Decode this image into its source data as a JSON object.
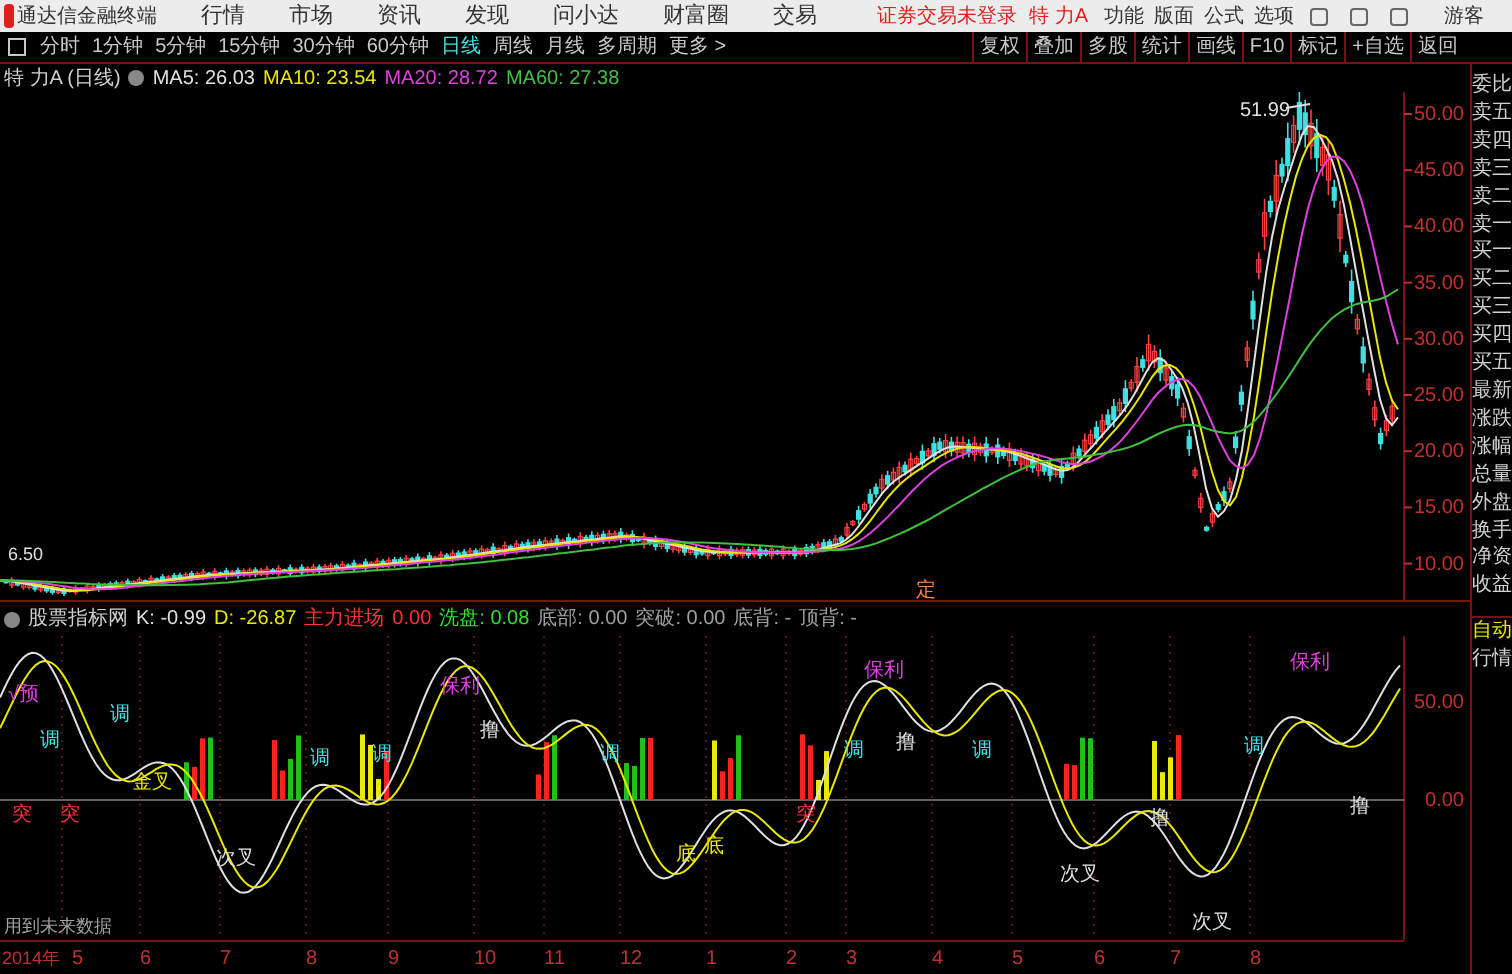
{
  "app": {
    "title": "通达信金融终端",
    "menu": [
      "行情",
      "市场",
      "资讯",
      "发现",
      "问小达",
      "财富圈",
      "交易"
    ],
    "login_status": "证券交易未登录",
    "stock": "特 力A",
    "right_menu": [
      "功能",
      "版面",
      "公式",
      "选项"
    ],
    "user": "游客"
  },
  "periods": [
    {
      "label": "分时",
      "selected": false
    },
    {
      "label": "1分钟",
      "selected": false
    },
    {
      "label": "5分钟",
      "selected": false
    },
    {
      "label": "15分钟",
      "selected": false
    },
    {
      "label": "30分钟",
      "selected": false
    },
    {
      "label": "60分钟",
      "selected": false
    },
    {
      "label": "日线",
      "selected": true
    },
    {
      "label": "周线",
      "selected": false
    },
    {
      "label": "月线",
      "selected": false
    },
    {
      "label": "多周期",
      "selected": false
    },
    {
      "label": "更多 >",
      "selected": false
    }
  ],
  "tools": [
    "复权",
    "叠加",
    "多股",
    "统计",
    "画线",
    "F10",
    "标记",
    "+自选",
    "返回"
  ],
  "price_chart": {
    "title": "特 力A (日线)",
    "ma": [
      {
        "text": "MA5: 26.03",
        "color": "#e0e0e0"
      },
      {
        "text": "MA10: 23.54",
        "color": "#e8e800"
      },
      {
        "text": "MA20: 28.72",
        "color": "#e040e0"
      },
      {
        "text": "MA60: 27.38",
        "color": "#40c040"
      }
    ],
    "axis": [
      "50.00",
      "45.00",
      "40.00",
      "35.00",
      "30.00",
      "25.00",
      "20.00",
      "15.00",
      "10.00"
    ],
    "high_label": "51.99",
    "low_label": "6.50",
    "marker": "定"
  },
  "indicator": {
    "name": "股票指标网",
    "values": [
      {
        "text": "K: -0.99",
        "color": "#e0e0e0"
      },
      {
        "text": "D: -26.87",
        "color": "#e8e800"
      },
      {
        "text": "主力进场",
        "color": "#ff3030"
      },
      {
        "text": "0.00",
        "color": "#ff3030"
      },
      {
        "text": "洗盘: 0.08",
        "color": "#30e030"
      },
      {
        "text": "底部: 0.00",
        "color": "#a0a0a0"
      },
      {
        "text": "突破: 0.00",
        "color": "#a0a0a0"
      },
      {
        "text": "底背: -",
        "color": "#a0a0a0"
      },
      {
        "text": "顶背: -",
        "color": "#a0a0a0"
      }
    ],
    "axis": [
      "50.00",
      "0.00"
    ],
    "annotations": [
      {
        "text": "√预",
        "color": "#e040e0"
      },
      {
        "text": "调",
        "color": "#40e0e0"
      },
      {
        "text": "调",
        "color": "#40e0e0"
      },
      {
        "text": "突",
        "color": "#ff3030"
      },
      {
        "text": "突",
        "color": "#ff3030"
      },
      {
        "text": "金叉",
        "color": "#e8e800"
      },
      {
        "text": "次叉",
        "color": "#e0e0e0"
      },
      {
        "text": "调",
        "color": "#40e0e0"
      },
      {
        "text": "调",
        "color": "#40e0e0"
      },
      {
        "text": "保利",
        "color": "#e040e0"
      },
      {
        "text": "撸",
        "color": "#e0e0e0"
      },
      {
        "text": "调",
        "color": "#40e0e0"
      },
      {
        "text": "底",
        "color": "#e8e800"
      },
      {
        "text": "底",
        "color": "#e8e800"
      },
      {
        "text": "突",
        "color": "#ff3030"
      },
      {
        "text": "调",
        "color": "#40e0e0"
      },
      {
        "text": "保利",
        "color": "#e040e0"
      },
      {
        "text": "撸",
        "color": "#e0e0e0"
      },
      {
        "text": "调",
        "color": "#40e0e0"
      },
      {
        "text": "次叉",
        "color": "#e0e0e0"
      },
      {
        "text": "撸",
        "color": "#e0e0e0"
      },
      {
        "text": "调",
        "color": "#40e0e0"
      },
      {
        "text": "次叉",
        "color": "#e0e0e0"
      },
      {
        "text": "保利",
        "color": "#e040e0"
      },
      {
        "text": "撸",
        "color": "#e0e0e0"
      }
    ],
    "note": "用到未来数据"
  },
  "dates": [
    "2014年",
    "5",
    "6",
    "7",
    "8",
    "9",
    "10",
    "11",
    "12",
    "1",
    "2",
    "3",
    "4",
    "5",
    "6",
    "7",
    "8"
  ],
  "quote_labels": [
    "委比",
    "卖五",
    "卖四",
    "卖三",
    "卖二",
    "卖一",
    "买一",
    "买二",
    "买三",
    "买四",
    "买五",
    "最新",
    "涨跌",
    "涨幅",
    "总量",
    "外盘",
    "换手",
    "净资",
    "收益"
  ],
  "quote_mode": [
    "自动",
    "行情"
  ]
}
